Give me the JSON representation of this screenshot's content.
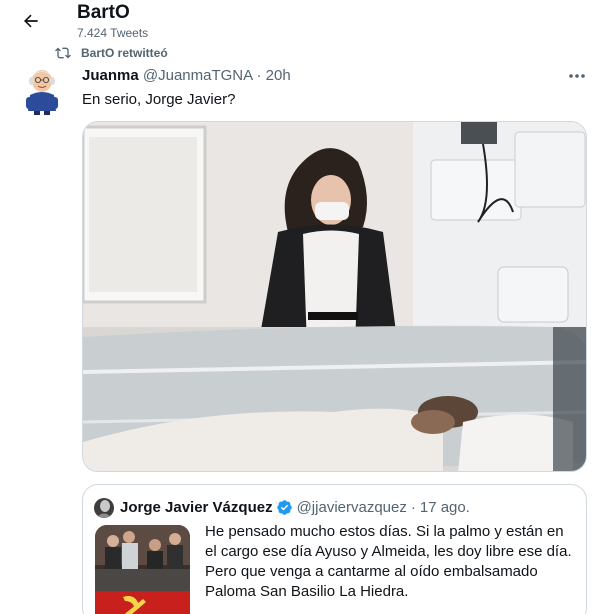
{
  "header": {
    "title": "BartO",
    "tweet_count": "7.424 Tweets",
    "back_icon": "arrow-left-icon"
  },
  "retweet": {
    "icon": "retweet-icon",
    "text": "BartO retwitteó"
  },
  "tweet": {
    "author_name": "Juanma",
    "handle": "@JuanmaTGNA",
    "separator": "·",
    "time": "20h",
    "text": "En serio, Jorge Javier?",
    "more_icon": "more-horizontal-icon"
  },
  "quote": {
    "author_name": "Jorge Javier Vázquez",
    "verified_icon": "verified-badge-icon",
    "handle": "@jjaviervazquez",
    "separator": "·",
    "time": "17 ago.",
    "lines": [
      "He pensado mucho estos días. Si la palmo y están en",
      "el cargo ese día Ayuso y Almeida, les doy libre ese día.",
      "Pero que venga a cantarme al oído embalsamado",
      "Paloma San Basilio La Hiedra."
    ]
  },
  "colors": {
    "text_primary": "#0f1419",
    "text_secondary": "#536471",
    "border": "#cfd9de",
    "verified_blue": "#1d9bf0"
  }
}
